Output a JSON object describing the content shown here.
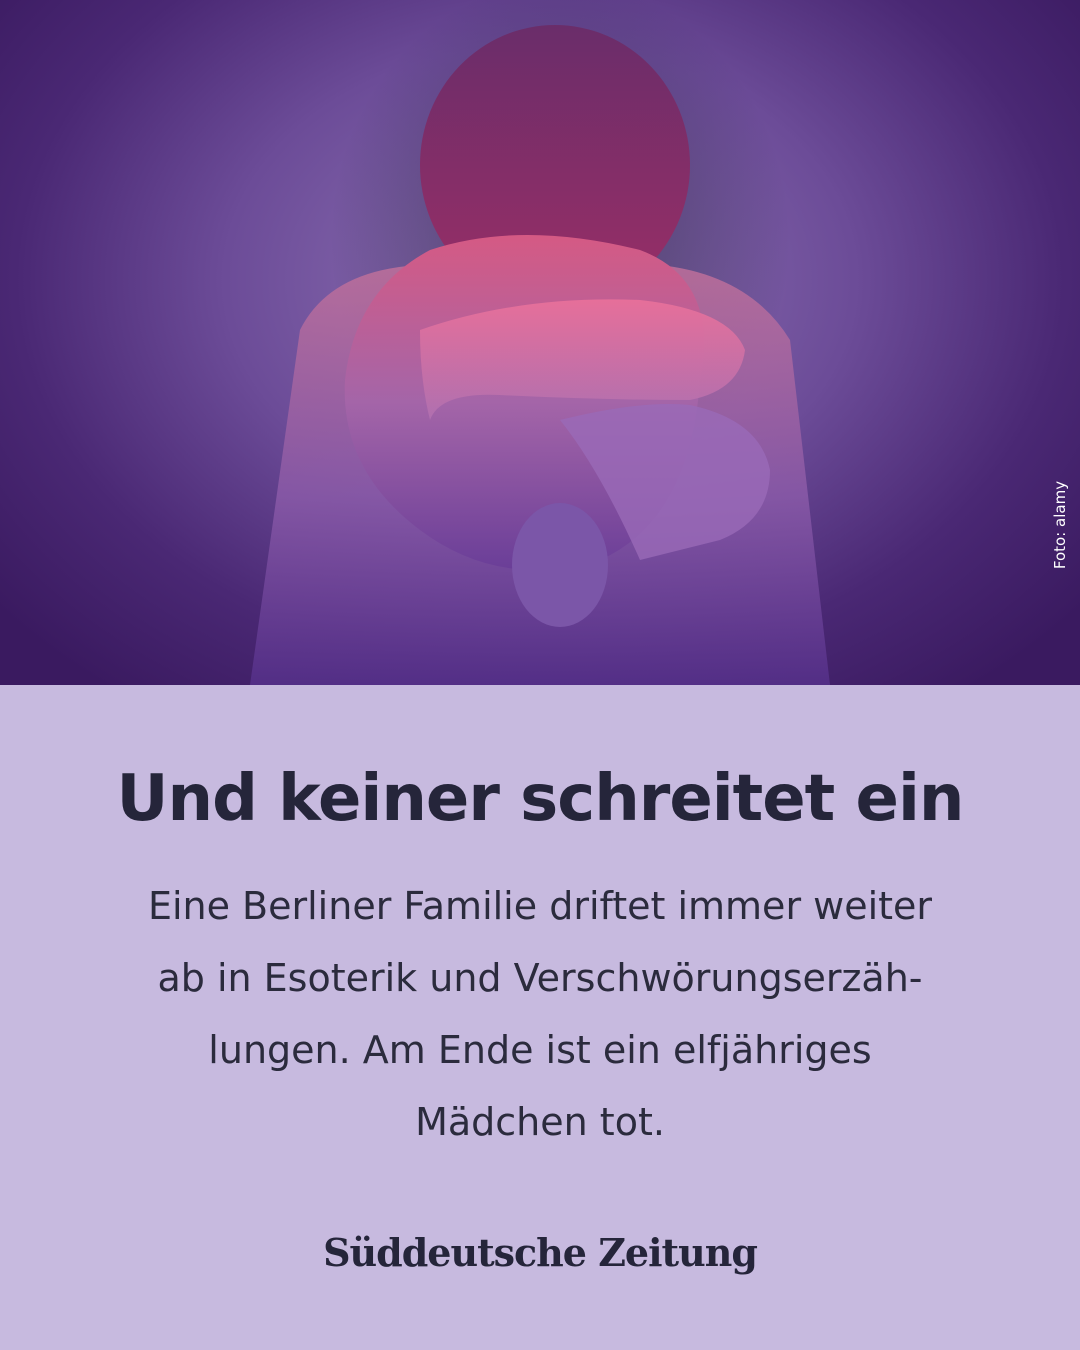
{
  "photo": {
    "credit": "Foto: alamy",
    "subject_icon": "child-hugging-pillow-illustration"
  },
  "article": {
    "headline": "Und keiner schreitet ein",
    "lede_lines": [
      "Eine Berliner Familie driftet immer weiter",
      "ab in Esoterik und Verschwörungserzäh-",
      "lungen. Am Ende ist ein elfjähriges",
      "Mädchen tot."
    ]
  },
  "brand": {
    "logo_text": "Süddeutsche Zeitung"
  },
  "colors": {
    "panel_background": "#c7badf",
    "headline_text": "#25253a",
    "photo_tint": "#6c4c98"
  }
}
